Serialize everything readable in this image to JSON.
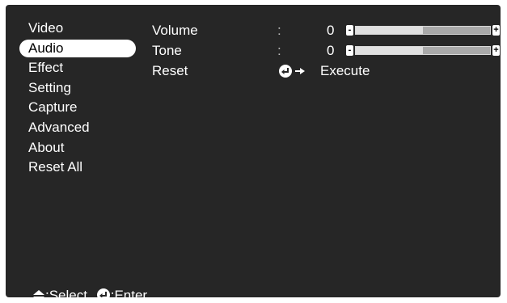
{
  "menu": {
    "items": [
      {
        "label": "Video"
      },
      {
        "label": "Audio",
        "selected": true
      },
      {
        "label": "Effect"
      },
      {
        "label": "Setting"
      },
      {
        "label": "Capture"
      },
      {
        "label": "Advanced"
      },
      {
        "label": "About"
      },
      {
        "label": "Reset All"
      }
    ]
  },
  "audio": {
    "volume": {
      "label": "Volume",
      "colon": ":",
      "value": "0",
      "level": 0.5
    },
    "tone": {
      "label": "Tone",
      "colon": ":",
      "value": "0",
      "level": 0.5
    },
    "reset": {
      "label": "Reset",
      "action_icon": "enter-arrow-icon",
      "action_label": "Execute"
    }
  },
  "footer": {
    "select_icon": "up-down-arrow-icon",
    "select_label": ":Select",
    "enter_icon": "enter-icon",
    "enter_label": ":Enter"
  },
  "colors": {
    "background": "#262626",
    "text": "#ffffff",
    "selected_bg": "#ffffff",
    "bar_dark": "#a9a9a9",
    "bar_light": "#e0e0e0"
  }
}
